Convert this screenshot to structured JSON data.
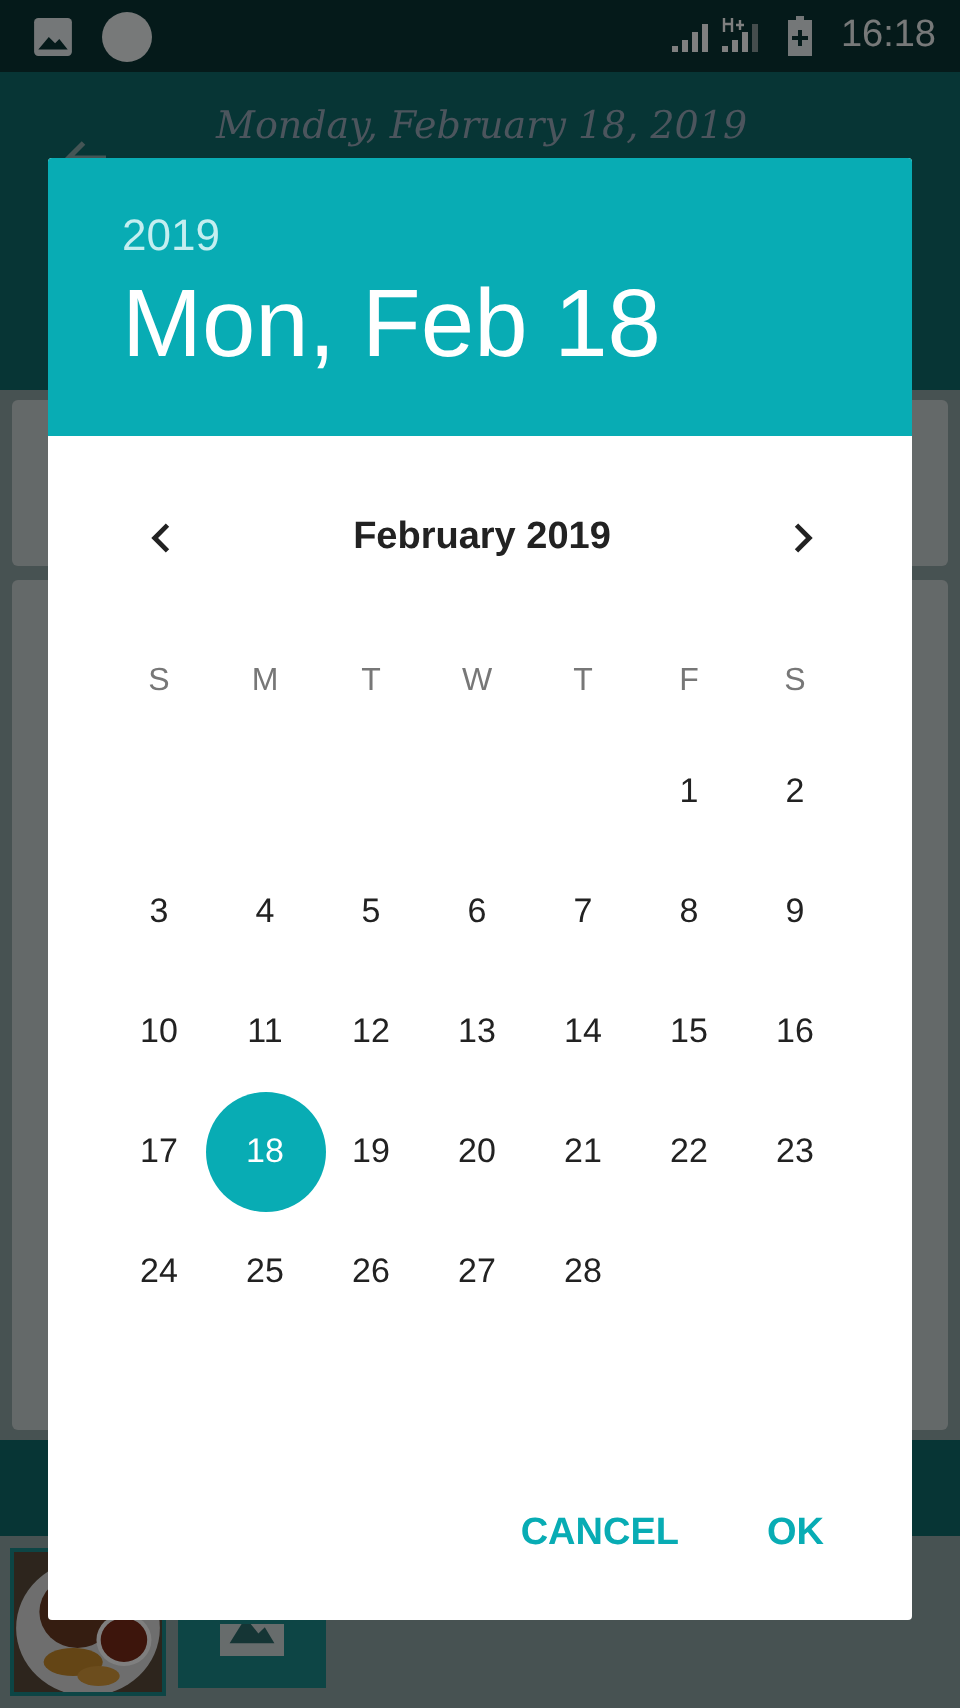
{
  "status_bar": {
    "time": "16:18"
  },
  "background": {
    "title": "Monday, February 18, 2019",
    "thumbnails": [
      {
        "kind": "picture"
      },
      {
        "kind": "placeholder"
      }
    ]
  },
  "dialog": {
    "year": "2019",
    "date": "Mon, Feb 18",
    "month": "February 2019",
    "weekdays": [
      "S",
      "M",
      "T",
      "W",
      "T",
      "F",
      "S"
    ],
    "weeks": [
      [
        {
          "label": "1",
          "selected": false
        },
        {
          "label": "2",
          "selected": false
        }
      ],
      [
        {
          "label": "3",
          "selected": false
        },
        {
          "label": "4",
          "selected": false
        },
        {
          "label": "5",
          "selected": false
        },
        {
          "label": "6",
          "selected": false
        },
        {
          "label": "7",
          "selected": false
        },
        {
          "label": "8",
          "selected": false
        },
        {
          "label": "9",
          "selected": false
        }
      ],
      [
        {
          "label": "10",
          "selected": false
        },
        {
          "label": "11",
          "selected": false
        },
        {
          "label": "12",
          "selected": false
        },
        {
          "label": "13",
          "selected": false
        },
        {
          "label": "14",
          "selected": false
        },
        {
          "label": "15",
          "selected": false
        },
        {
          "label": "16",
          "selected": false
        }
      ],
      [
        {
          "label": "17",
          "selected": false
        },
        {
          "label": "18",
          "selected": true
        },
        {
          "label": "19",
          "selected": false
        },
        {
          "label": "20",
          "selected": false
        },
        {
          "label": "21",
          "selected": false
        },
        {
          "label": "22",
          "selected": false
        },
        {
          "label": "23",
          "selected": false
        }
      ],
      [
        {
          "label": "24",
          "selected": false
        },
        {
          "label": "25",
          "selected": false
        },
        {
          "label": "26",
          "selected": false
        },
        {
          "label": "27",
          "selected": false
        },
        {
          "label": "28",
          "selected": false
        }
      ]
    ],
    "buttons": [
      "CANCEL",
      "OK"
    ]
  }
}
